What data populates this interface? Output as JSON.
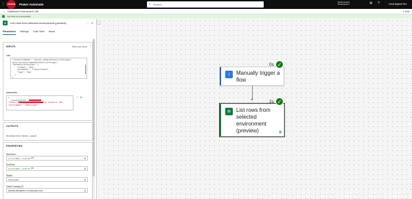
{
  "topbar": {
    "logo_text": "POWER",
    "app_title": "Power Automate",
    "search_placeholder": "Search",
    "env_label": "Environments",
    "env_name": "Development",
    "user_name": "Lewis Baybutt Dev"
  },
  "subbar": {
    "flow_name": "Dataverse Environment Call",
    "exit_label": "Exit"
  },
  "banner": {
    "message": "Your flow ran successfully."
  },
  "panel": {
    "title": "List rows from selected environment (preview)",
    "tabs": [
      "Parameters",
      "Settings",
      "Code View",
      "About"
    ],
    "inputs": {
      "heading": "INPUTS",
      "show_raw": "Show raw inputs",
      "host_label": "host",
      "host_lines": [
        "\"connectionName\": \"shared_commondataserviceforapps\",",
        "apim.net/apim/commondataserviceforapps\",",
        "\"authenticationType\": {",
        "    \"schema\": \"Key\",",
        "    \"parameter\": \"connectionId\",",
        "    \"type\": \"Key\"",
        "  }",
        "}"
      ],
      "params_label": "parameters",
      "param_org_key": "\"organization\":",
      "param_org_prefix": "\"https://",
      "param_org_suffix": "ral.dynamics.com\",",
      "param_entity": "\"entityName\": \"admin_apps\""
    },
    "outputs": {
      "heading": "OUTPUTS",
      "download": "Download (Alt or Option + select)"
    },
    "properties": {
      "heading": "PROPERTIES",
      "start_label": "Start time",
      "start_value": "11/13/2023, 9:45:56",
      "start_ampm": "PM",
      "end_label": "End time",
      "end_value": "11/13/2023, 9:45:41",
      "end_ampm": "PM",
      "status_label": "Status",
      "status_value": "Succeeded",
      "tracking_label": "Client Tracking ID",
      "tracking_value": "08585838948081977978684847332S"
    }
  },
  "canvas": {
    "trigger": {
      "title": "Manually trigger a flow",
      "duration": "0s"
    },
    "action": {
      "title": "List rows from selected environment (preview)",
      "duration": "2s"
    }
  },
  "colors": {
    "topbar_bg": "#0f0f0f",
    "banner_bg": "#dff6dd",
    "success": "#107c10",
    "trigger_accent": "#2b78e4",
    "action_accent": "#107c41",
    "link": "#0f6cbd"
  }
}
